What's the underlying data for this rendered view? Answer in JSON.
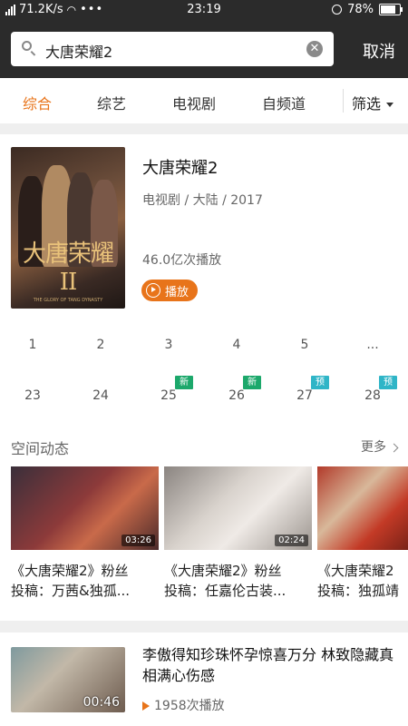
{
  "status": {
    "speed": "71.2K/s",
    "time": "23:19",
    "battery": "78%",
    "battery_level": 0.78
  },
  "search": {
    "query": "大唐荣耀2",
    "clear_icon": "close-circle-icon",
    "cancel": "取消"
  },
  "tabs": [
    {
      "label": "综合",
      "active": true
    },
    {
      "label": "综艺",
      "active": false
    },
    {
      "label": "电视剧",
      "active": false
    },
    {
      "label": "自频道",
      "active": false
    }
  ],
  "filter": "筛选",
  "result": {
    "poster_logo": "大唐荣耀II",
    "poster_sub": "THE GLORY OF TANG DYNASTY",
    "title": "大唐荣耀2",
    "meta": "电视剧 / 大陆 / 2017",
    "plays": "46.0亿次播放",
    "play_label": "播放"
  },
  "episodes": {
    "row1": [
      "1",
      "2",
      "3",
      "4",
      "5",
      "..."
    ],
    "row2": [
      {
        "num": "23",
        "badge": ""
      },
      {
        "num": "24",
        "badge": ""
      },
      {
        "num": "25",
        "badge": "新"
      },
      {
        "num": "26",
        "badge": "新"
      },
      {
        "num": "27",
        "badge": "预"
      },
      {
        "num": "28",
        "badge": "预"
      }
    ]
  },
  "space": {
    "title": "空间动态",
    "more": "更多",
    "clips": [
      {
        "duration": "03:26",
        "line1": "《大唐荣耀2》粉丝",
        "line2": "投稿：万茜&独孤..."
      },
      {
        "duration": "02:24",
        "line1": "《大唐荣耀2》粉丝",
        "line2": "投稿：任嘉伦古装..."
      },
      {
        "duration": "",
        "line1": "《大唐荣耀2",
        "line2": "投稿：独孤靖"
      }
    ]
  },
  "video": {
    "duration": "00:46",
    "title": "李傲得知珍珠怀孕惊喜万分 林致隐藏真相满心伤感",
    "plays": "1958次播放"
  },
  "colors": {
    "accent": "#e8741a",
    "badge_new": "#1ca86b",
    "badge_preview": "#2fb5c7"
  }
}
